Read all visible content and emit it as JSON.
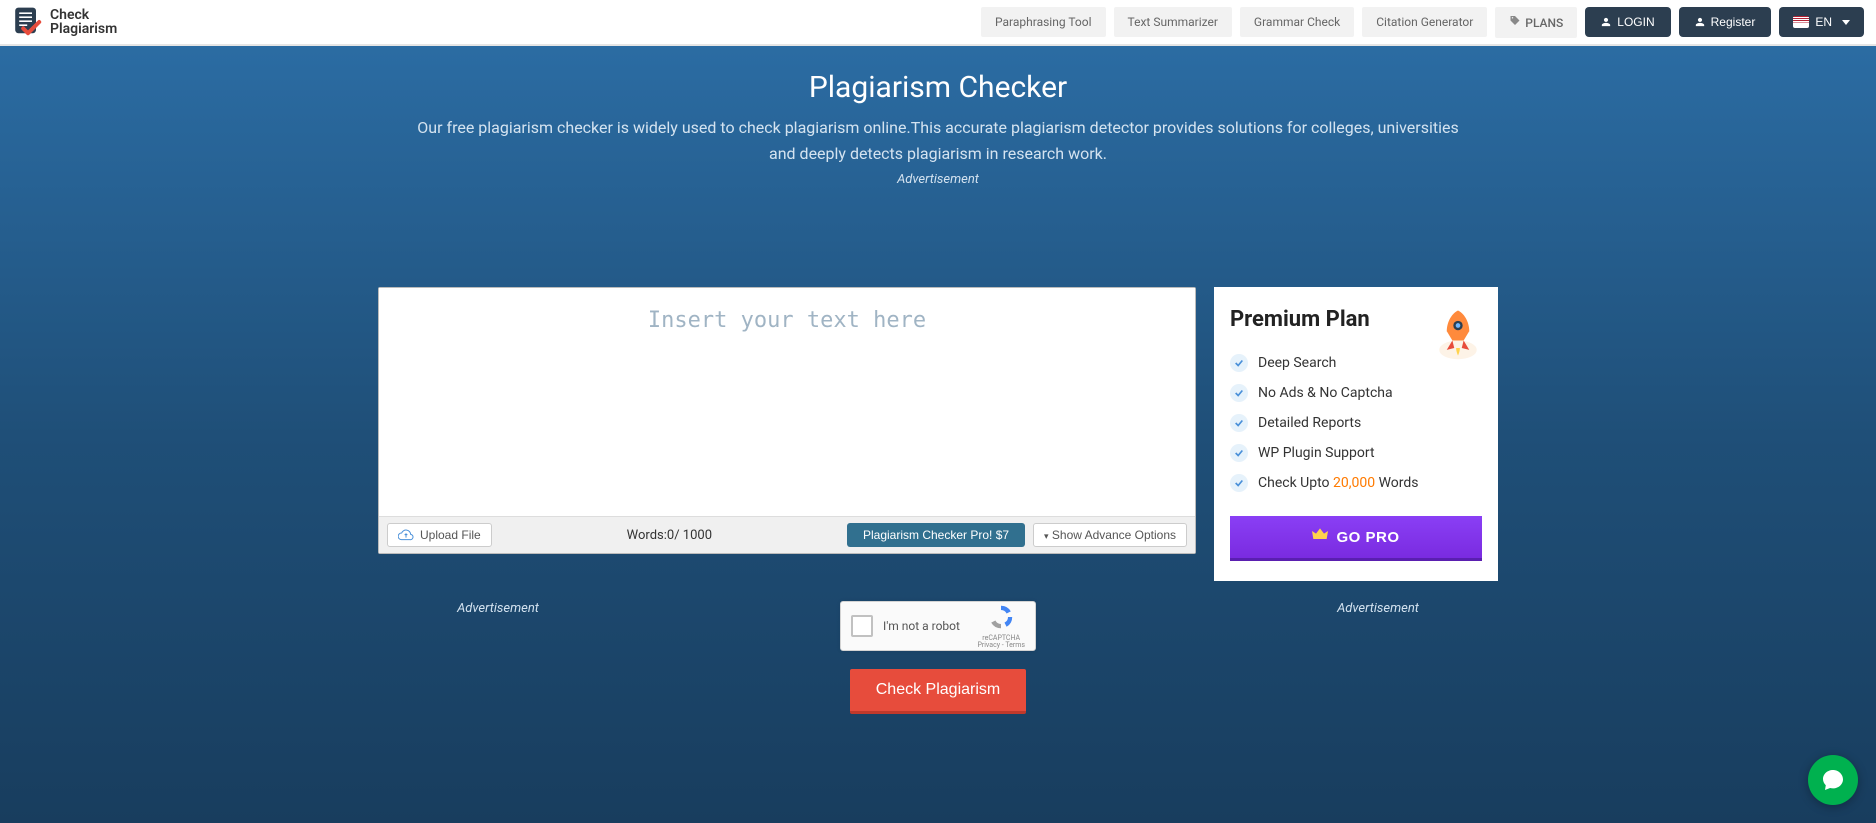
{
  "brand": {
    "line1": "Check",
    "line2": "Plagiarism"
  },
  "nav": {
    "links": [
      "Paraphrasing Tool",
      "Text Summarizer",
      "Grammar Check",
      "Citation Generator"
    ],
    "plans": "PLANS",
    "login": "LOGIN",
    "register": "Register",
    "lang": "EN"
  },
  "hero": {
    "title": "Plagiarism Checker",
    "subtitle": "Our free plagiarism checker is widely used to check plagiarism online.This accurate plagiarism detector provides solutions for colleges, universities and deeply detects plagiarism in research work.",
    "ad_label": "Advertisement"
  },
  "editor": {
    "placeholder": "Insert your text here",
    "upload": "Upload File",
    "words_label": "Words:",
    "words_current": "0",
    "words_max": "1000",
    "pro_label": "Plagiarism Checker Pro! $7",
    "advance": "Show Advance Options"
  },
  "premium": {
    "title": "Premium Plan",
    "features": [
      "Deep Search",
      "No Ads & No Captcha",
      "Detailed Reports",
      "WP Plugin Support"
    ],
    "check_upto_prefix": "Check Upto ",
    "check_upto_number": "20,000",
    "check_upto_suffix": " Words",
    "gopro": "GO PRO"
  },
  "captcha": {
    "text": "I'm not a robot",
    "brand": "reCAPTCHA",
    "legal": "Privacy - Terms"
  },
  "check_button": "Check Plagiarism",
  "ad_side": "Advertisement"
}
